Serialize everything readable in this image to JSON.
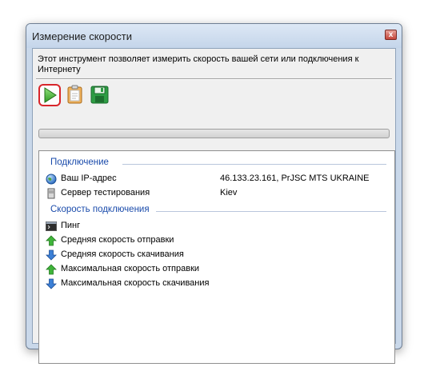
{
  "window": {
    "title": "Измерение скорости",
    "close_label": "x"
  },
  "description": "Этот инструмент позволяет измерить скорость вашей сети или подключения к Интернету",
  "toolbar": {
    "start_icon": "play-icon",
    "copy_icon": "clipboard-icon",
    "save_icon": "save-icon"
  },
  "progress": {
    "value": 0
  },
  "connection": {
    "title": "Подключение",
    "rows": [
      {
        "label": "Ваш IP-адрес",
        "value": "46.133.23.161, PrJSC MTS UKRAINE",
        "icon": "globe-icon"
      },
      {
        "label": "Сервер тестирования",
        "value": "Kiev",
        "icon": "server-icon"
      }
    ]
  },
  "speed": {
    "title": "Скорость подключения",
    "rows": [
      {
        "label": "Пинг",
        "icon": "console-icon"
      },
      {
        "label": "Средняя скорость отправки",
        "icon": "arrow-up-icon"
      },
      {
        "label": "Средняя скорость скачивания",
        "icon": "arrow-down-icon"
      },
      {
        "label": "Максимальная скорость отправки",
        "icon": "arrow-up-icon"
      },
      {
        "label": "Максимальная скорость скачивания",
        "icon": "arrow-down-icon"
      }
    ]
  },
  "colors": {
    "group_title": "#1a4bab",
    "start_highlight": "#d8262b",
    "arrow_up": "#3fb43a",
    "arrow_down": "#3b7fd6"
  }
}
